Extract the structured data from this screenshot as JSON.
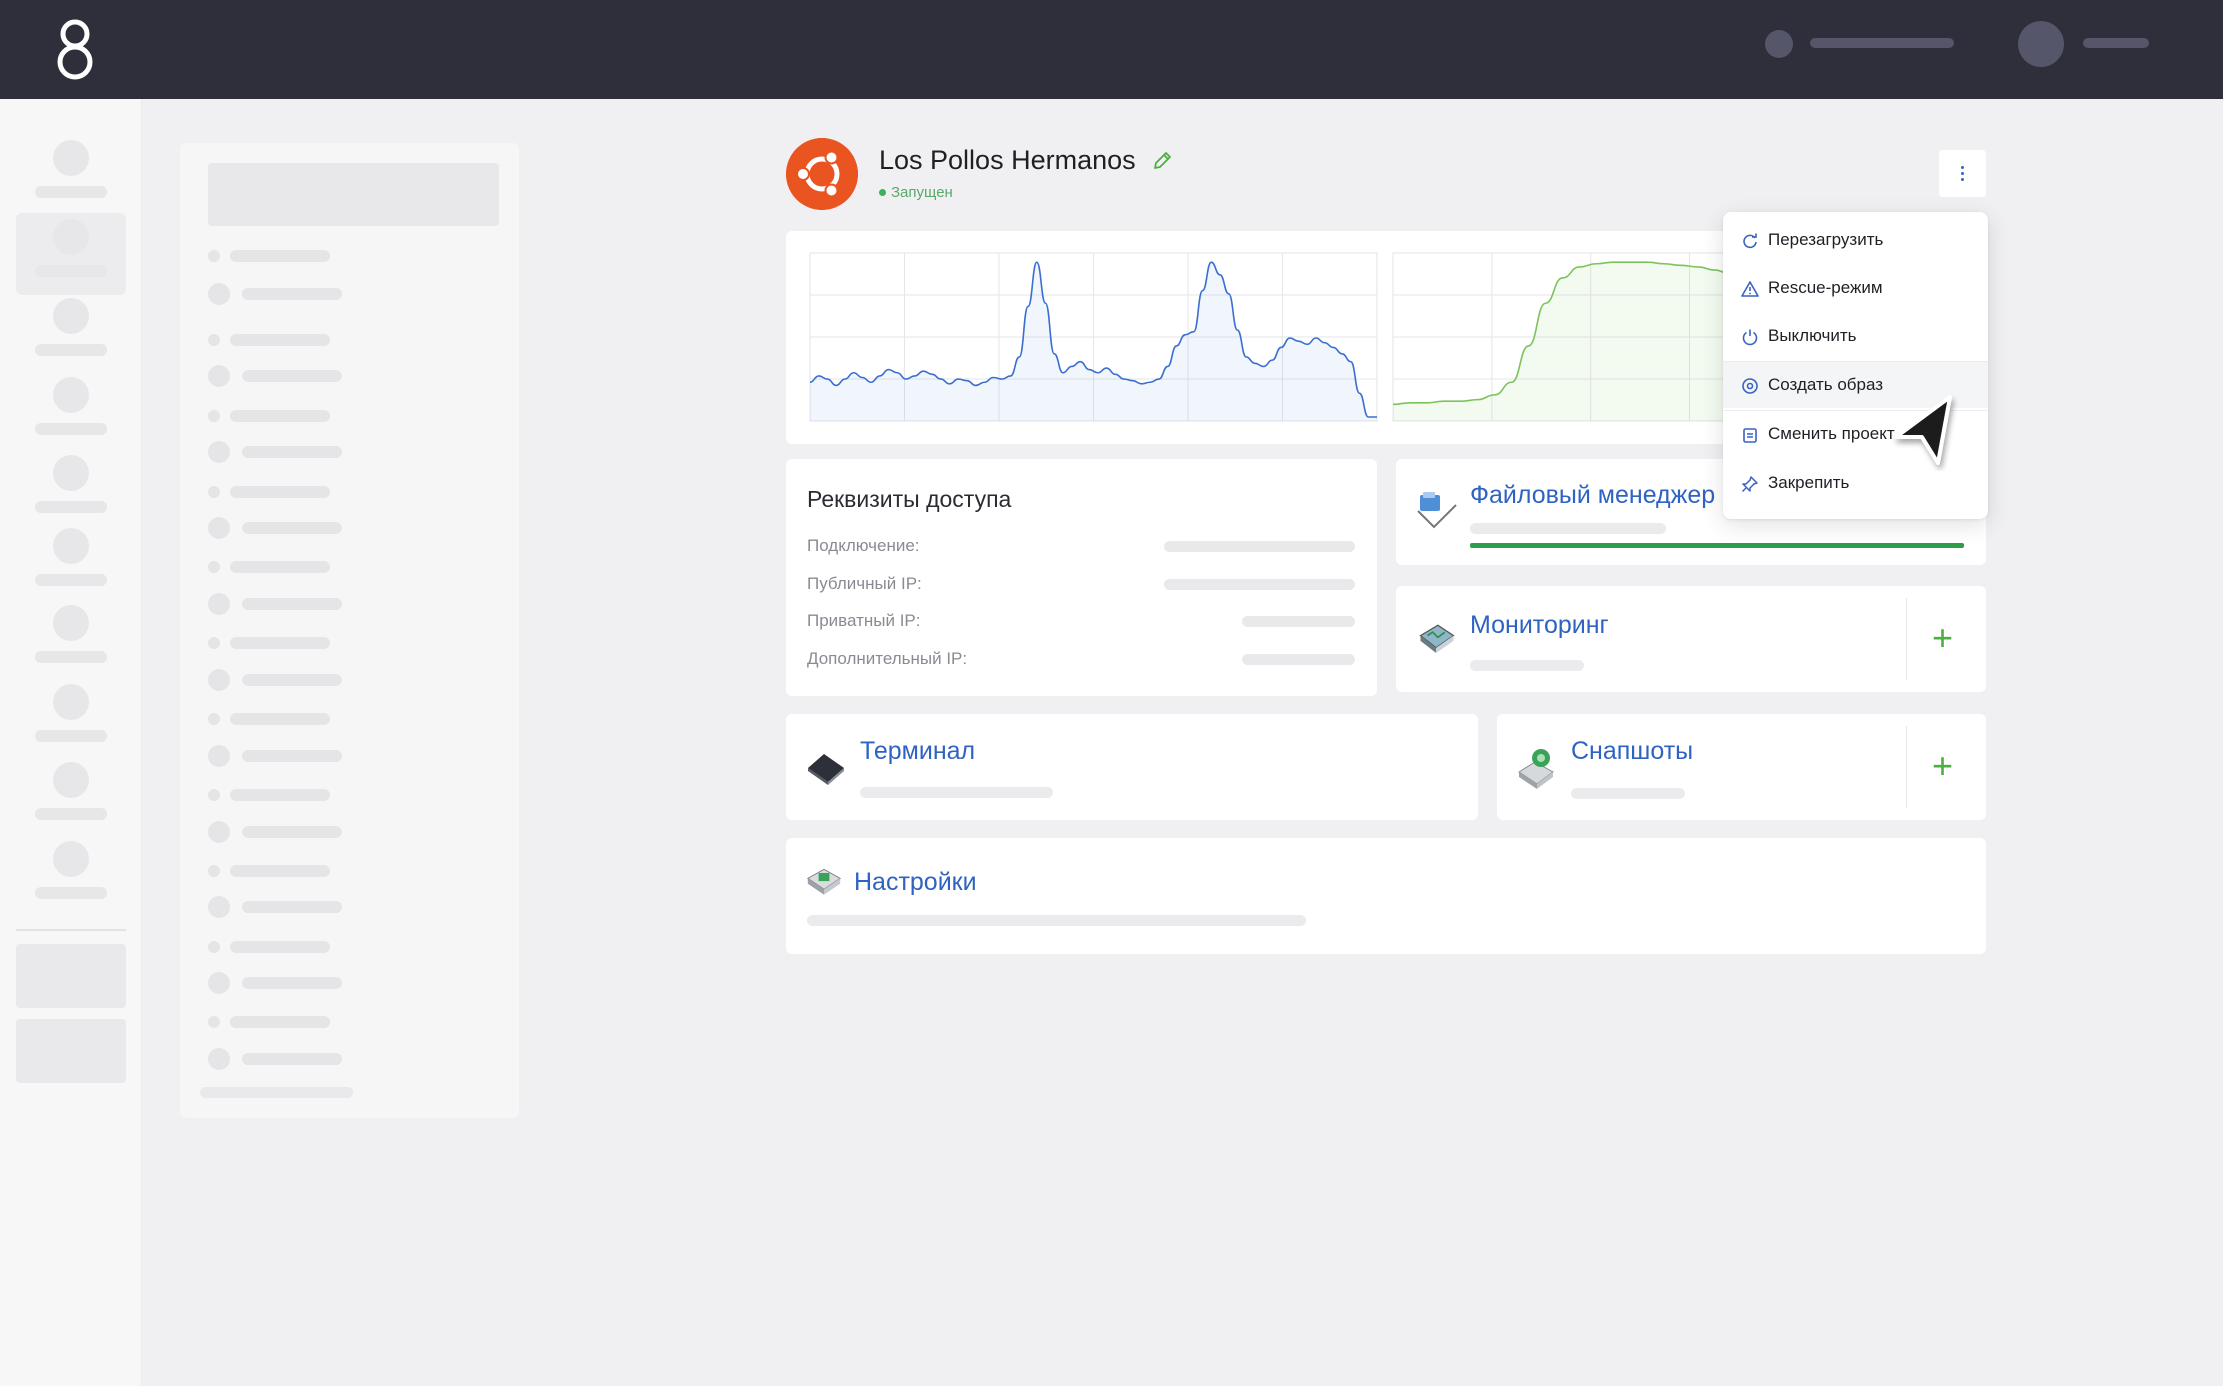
{
  "server": {
    "name": "Los Pollos Hermanos",
    "status": "Запущен",
    "os_logo": "ubuntu-logo"
  },
  "menu": {
    "items": [
      {
        "label": "Перезагрузить",
        "icon": "reload-icon"
      },
      {
        "label": "Rescue-режим",
        "icon": "warning-icon"
      },
      {
        "label": "Выключить",
        "icon": "power-icon"
      },
      {
        "label": "Создать образ",
        "icon": "disk-image-icon"
      },
      {
        "label": "Сменить проект",
        "icon": "folder-swap-icon"
      },
      {
        "label": "Закрепить",
        "icon": "pin-icon"
      }
    ],
    "hovered_index": 3
  },
  "access": {
    "title": "Реквизиты доступа",
    "rows": [
      {
        "label": "Подключение:"
      },
      {
        "label": "Публичный IP:"
      },
      {
        "label": "Приватный IP:"
      },
      {
        "label": "Дополнительный IP:"
      }
    ]
  },
  "services": {
    "file_manager": {
      "title": "Файловый менеджер"
    },
    "monitoring": {
      "title": "Мониторинг",
      "action": "+"
    },
    "terminal": {
      "title": "Терминал"
    },
    "snapshots": {
      "title": "Снапшоты",
      "action": "+"
    },
    "settings": {
      "title": "Настройки"
    }
  },
  "colors": {
    "topbar": "#2e2f3b",
    "accent_blue": "#2f63c2",
    "accent_green": "#4caf3f",
    "ubuntu_orange": "#e95420",
    "cpu_line": "#3a6fd0",
    "net_line": "#7cc35a"
  },
  "chart_data": [
    {
      "type": "area",
      "x": [
        0,
        1,
        2,
        3,
        4,
        5,
        6,
        7,
        8,
        9,
        10,
        11,
        12,
        13,
        14,
        15,
        16,
        17,
        18,
        19,
        20,
        21,
        22,
        23,
        24,
        25,
        26,
        27,
        28,
        29,
        30,
        31,
        32,
        33,
        34,
        35,
        36,
        37,
        38,
        39,
        40,
        41,
        42,
        43,
        44,
        45,
        46,
        47,
        48,
        49,
        50,
        51,
        52,
        53,
        54,
        55,
        56,
        57,
        58,
        59,
        60,
        61,
        62,
        63,
        64,
        65
      ],
      "values": [
        22,
        26,
        24,
        20,
        24,
        28,
        25,
        22,
        26,
        30,
        28,
        24,
        26,
        29,
        27,
        24,
        21,
        24,
        23,
        20,
        22,
        25,
        24,
        26,
        38,
        70,
        98,
        72,
        40,
        28,
        32,
        35,
        30,
        28,
        31,
        27,
        24,
        23,
        21,
        22,
        24,
        32,
        45,
        52,
        54,
        80,
        98,
        90,
        78,
        55,
        38,
        34,
        32,
        36,
        44,
        50,
        48,
        46,
        50,
        47,
        44,
        40,
        35,
        15,
        0,
        0
      ],
      "ylim": [
        0,
        100
      ]
    },
    {
      "type": "area",
      "x": [
        0,
        1,
        2,
        3,
        4,
        5,
        6,
        7,
        8,
        9,
        10,
        11,
        12,
        13,
        14,
        15,
        16,
        17,
        18,
        19,
        20,
        21,
        22,
        23,
        24,
        25,
        26,
        27,
        28,
        29,
        30,
        31,
        32,
        33,
        34,
        35
      ],
      "values": [
        8,
        9,
        9,
        10,
        10,
        11,
        14,
        22,
        45,
        72,
        88,
        95,
        97,
        98,
        98,
        98,
        97,
        96,
        95,
        93,
        90,
        88,
        86,
        84,
        82,
        80,
        79,
        78,
        78,
        78,
        77,
        77,
        76,
        76,
        75,
        75
      ],
      "ylim": [
        0,
        100
      ]
    }
  ]
}
